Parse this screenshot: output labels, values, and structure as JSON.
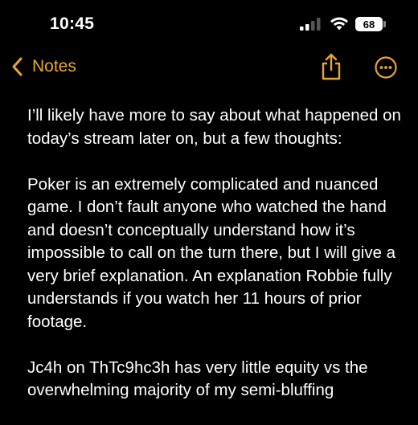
{
  "status_bar": {
    "time": "10:45",
    "battery": "68"
  },
  "nav": {
    "back_label": "Notes"
  },
  "note": {
    "paragraphs": [
      "I’ll likely have more to say about what happened on today’s stream later on, but a few thoughts:",
      "Poker is an extremely complicated and nuanced game. I don’t fault anyone who watched the hand and doesn’t conceptually understand how it’s impossible to call on the turn there, but I will give a very brief explanation. An explanation Robbie fully understands if you watch her 11 hours of prior footage.",
      "Jc4h on ThTc9hc3h has very little equity vs the overwhelming majority of my semi-bluffing"
    ]
  },
  "colors": {
    "accent": "#e8a630",
    "background": "#000000",
    "text": "#ffffff"
  },
  "icons": [
    "cellular-signal-icon",
    "wifi-icon",
    "battery-icon",
    "chevron-left-icon",
    "share-icon",
    "more-icon"
  ]
}
